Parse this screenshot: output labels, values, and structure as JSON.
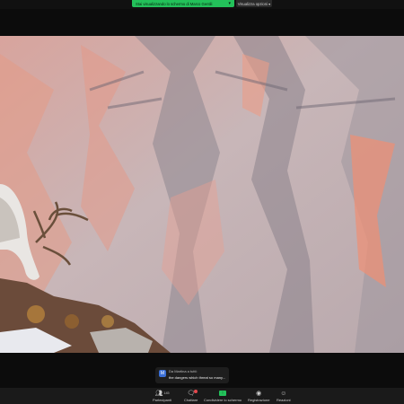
{
  "banner": {
    "share_text": "Stai visualizzando lo schermo di Marco Gentili",
    "chevron": "▾",
    "view_options": "Visualizza opzioni ▾"
  },
  "chat_toast": {
    "avatar_letter": "M",
    "from": "Da Martina a tutti:",
    "message": "the dangers which threat so many..."
  },
  "toolbar": {
    "participants_label": "Partecipanti",
    "participants_count": "145",
    "chat_label": "Chattare",
    "share_label": "Condividere lo schermo",
    "record_label": "Registrazione",
    "reactions_label": "Reazioni"
  },
  "icons": [
    "people-icon",
    "chat-icon",
    "share-screen-icon",
    "record-icon",
    "reaction-icon"
  ],
  "colors": {
    "share_green": "#23c15a",
    "toolbar_bg": "#1a1a1a",
    "badge_red": "#e5484d"
  }
}
